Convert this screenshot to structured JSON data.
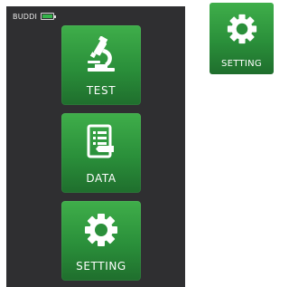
{
  "status_bar": {
    "device_name": "BUDDI",
    "battery_icon": "battery-full-icon",
    "battery_color": "#34b34a"
  },
  "menu": {
    "items": [
      {
        "label": "TEST",
        "icon": "microscope-icon"
      },
      {
        "label": "DATA",
        "icon": "document-icon"
      },
      {
        "label": "SETTING",
        "icon": "gear-icon"
      }
    ]
  },
  "preview_tile": {
    "label": "SETTING",
    "icon": "gear-icon"
  },
  "colors": {
    "background": "#2f2f31",
    "tile_green_top": "#3fae4a",
    "tile_green_bottom": "#1f6e2d",
    "icon_color": "#ffffff"
  }
}
